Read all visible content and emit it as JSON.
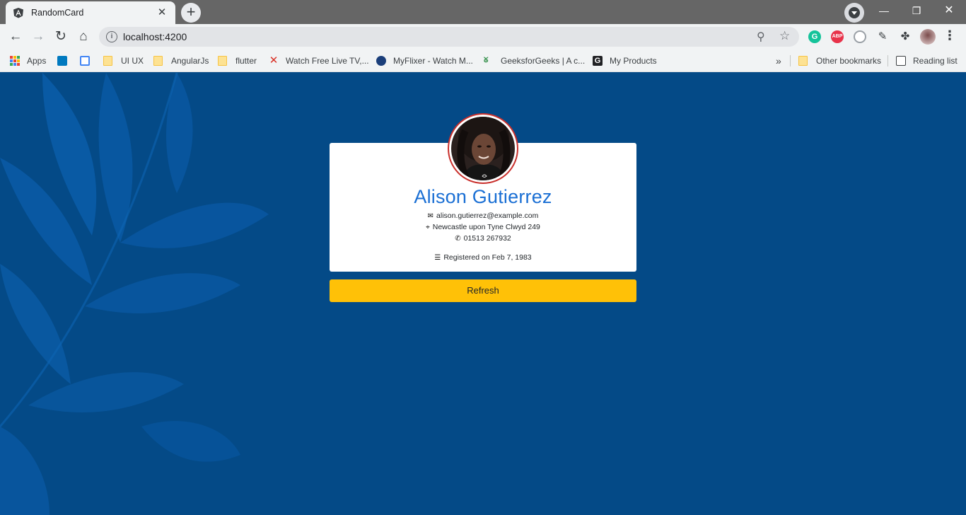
{
  "browser": {
    "tab_title": "RandomCard",
    "url": "localhost:4200",
    "bookmarks": [
      {
        "label": "Apps",
        "icon": "apps-grid-icon"
      },
      {
        "label": "",
        "icon": "trello-icon"
      },
      {
        "label": "",
        "icon": "calendar-icon"
      },
      {
        "label": "UI UX",
        "icon": "folder-icon"
      },
      {
        "label": "AngularJs",
        "icon": "folder-icon"
      },
      {
        "label": "flutter",
        "icon": "folder-icon"
      },
      {
        "label": "Watch Free Live TV,...",
        "icon": "x-icon"
      },
      {
        "label": "MyFlixer - Watch M...",
        "icon": "film-icon"
      },
      {
        "label": "GeeksforGeeks | A c...",
        "icon": "gfg-icon"
      },
      {
        "label": "My Products",
        "icon": "g-icon"
      }
    ],
    "overflow_label": "»",
    "other_bookmarks": "Other bookmarks",
    "reading_list": "Reading list"
  },
  "card": {
    "name": "Alison  Gutierrez",
    "email": "alison.gutierrez@example.com",
    "address": "Newcastle upon Tyne Clwyd 249",
    "phone": "01513 267932",
    "registered": "Registered on Feb 7, 1983"
  },
  "actions": {
    "refresh_label": "Refresh"
  },
  "colors": {
    "page_background": "#044a87",
    "name_color": "#1a6fd4",
    "refresh_button": "#ffc107",
    "avatar_border": "#c9302c"
  }
}
